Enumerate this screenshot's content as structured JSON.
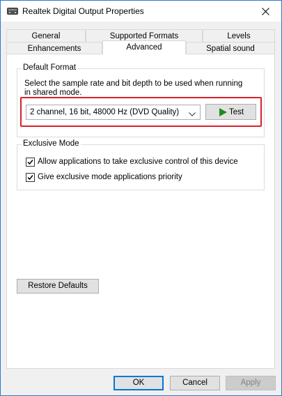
{
  "window": {
    "title": "Realtek Digital Output Properties",
    "icons": {
      "app": "speaker-icon",
      "close": "close-icon"
    }
  },
  "tabs": {
    "row1": [
      "General",
      "Supported Formats",
      "Levels"
    ],
    "row2": [
      "Enhancements",
      "Advanced",
      "Spatial sound"
    ],
    "active": "Advanced"
  },
  "default_format": {
    "group_label": "Default Format",
    "description_line1": "Select the sample rate and bit depth to be used when running",
    "description_line2": "in shared mode.",
    "selected_format": "2 channel, 16 bit, 48000 Hz (DVD Quality)",
    "test_label": "Test",
    "icons": {
      "dropdown": "chevron-down-icon",
      "test": "play-icon"
    }
  },
  "exclusive_mode": {
    "group_label": "Exclusive Mode",
    "allow_exclusive_label": "Allow applications to take exclusive control of this device",
    "allow_exclusive_checked": true,
    "priority_label": "Give exclusive mode applications priority",
    "priority_checked": true
  },
  "restore_defaults_label": "Restore Defaults",
  "footer": {
    "ok_label": "OK",
    "cancel_label": "Cancel",
    "apply_label": "Apply"
  },
  "colors": {
    "highlight": "#d9202b",
    "play_icon": "#1e8c1e",
    "window_border": "#2b79c7"
  }
}
